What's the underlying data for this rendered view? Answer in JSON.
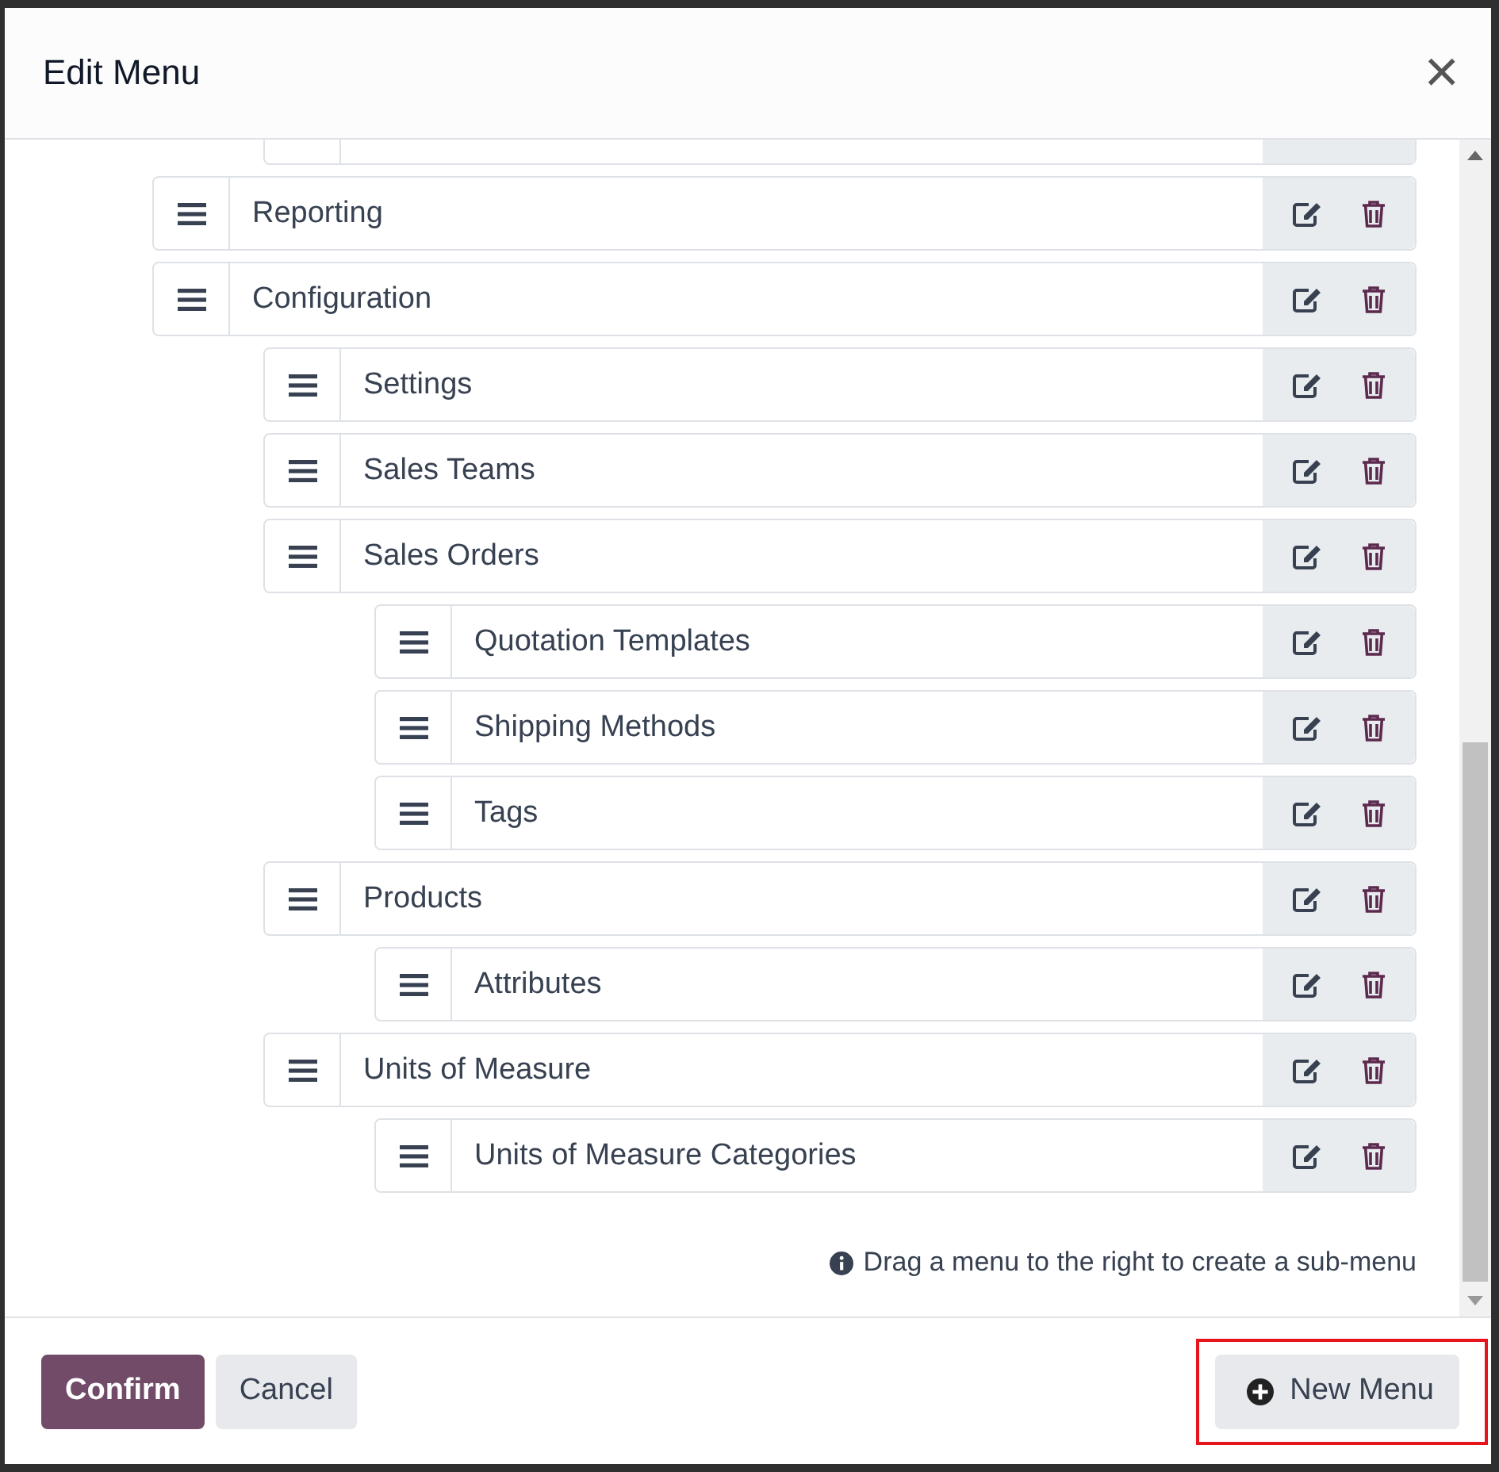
{
  "dialog": {
    "title": "Edit Menu",
    "close": "×"
  },
  "menu_items": [
    {
      "label": "Reporting"
    },
    {
      "label": "Configuration",
      "children": [
        {
          "label": "Settings"
        },
        {
          "label": "Sales Teams"
        },
        {
          "label": "Sales Orders",
          "children": [
            {
              "label": "Quotation Templates"
            },
            {
              "label": "Shipping Methods"
            },
            {
              "label": "Tags"
            }
          ]
        },
        {
          "label": "Products",
          "children": [
            {
              "label": "Attributes"
            }
          ]
        },
        {
          "label": "Units of Measure",
          "children": [
            {
              "label": "Units of Measure Categories"
            }
          ]
        }
      ]
    }
  ],
  "hint": "Drag a menu to the right to create a sub-menu",
  "buttons": {
    "confirm": "Confirm",
    "cancel": "Cancel",
    "new_menu": "New Menu",
    "new_menu_highlighted": true
  }
}
